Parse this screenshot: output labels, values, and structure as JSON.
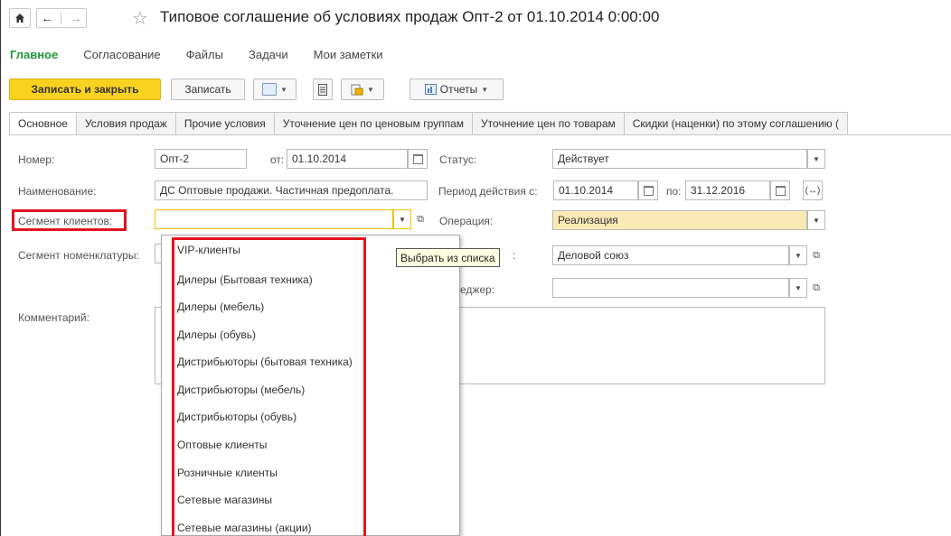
{
  "window": {
    "title": "Типовое соглашение об условиях продаж Опт-2 от 01.10.2014 0:00:00"
  },
  "sections": [
    "Главное",
    "Согласование",
    "Файлы",
    "Задачи",
    "Мои заметки"
  ],
  "toolbar": {
    "save_close": "Записать и закрыть",
    "save": "Записать",
    "reports": "Отчеты"
  },
  "tabs": [
    "Основное",
    "Условия продаж",
    "Прочие условия",
    "Уточнение цен по ценовым группам",
    "Уточнение цен по товарам",
    "Скидки (наценки) по этому соглашению ("
  ],
  "form": {
    "number_label": "Номер:",
    "number_value": "Опт-2",
    "from_label": "от:",
    "date_value": "01.10.2014",
    "status_label": "Статус:",
    "status_value": "Действует",
    "name_label": "Наименование:",
    "name_value": "ДС Оптовые продажи. Частичная предоплата.",
    "period_label": "Период действия с:",
    "period_from": "01.10.2014",
    "period_to_label": "по:",
    "period_to": "31.12.2016",
    "segment_clients_label": "Сегмент клиентов:",
    "segment_clients_value": "",
    "operation_label": "Операция:",
    "operation_value": "Реализация",
    "segment_nom_label": "Сегмент номенклатуры:",
    "org_suffix": ":",
    "org_value": "Деловой союз",
    "manager_label": "еджер:",
    "manager_value": "",
    "comment_label": "Комментарий:"
  },
  "tooltip": "Выбрать из списка",
  "dropdown": {
    "options": [
      "VIP-клиенты",
      "Дилеры (Бытовая техника)",
      "Дилеры (мебель)",
      "Дилеры (обувь)",
      "Дистрибьюторы (бытовая техника)",
      "Дистрибьюторы (мебель)",
      "Дистрибьюторы (обувь)",
      "Оптовые клиенты",
      "Розничные клиенты",
      "Сетевые магазины",
      "Сетевые магазины (акции)"
    ]
  },
  "colors": {
    "accent_green": "#1c9a3a",
    "primary_button": "#f9d21f",
    "highlight_red": "#e3141f",
    "operation_field": "#fbe9b5"
  }
}
